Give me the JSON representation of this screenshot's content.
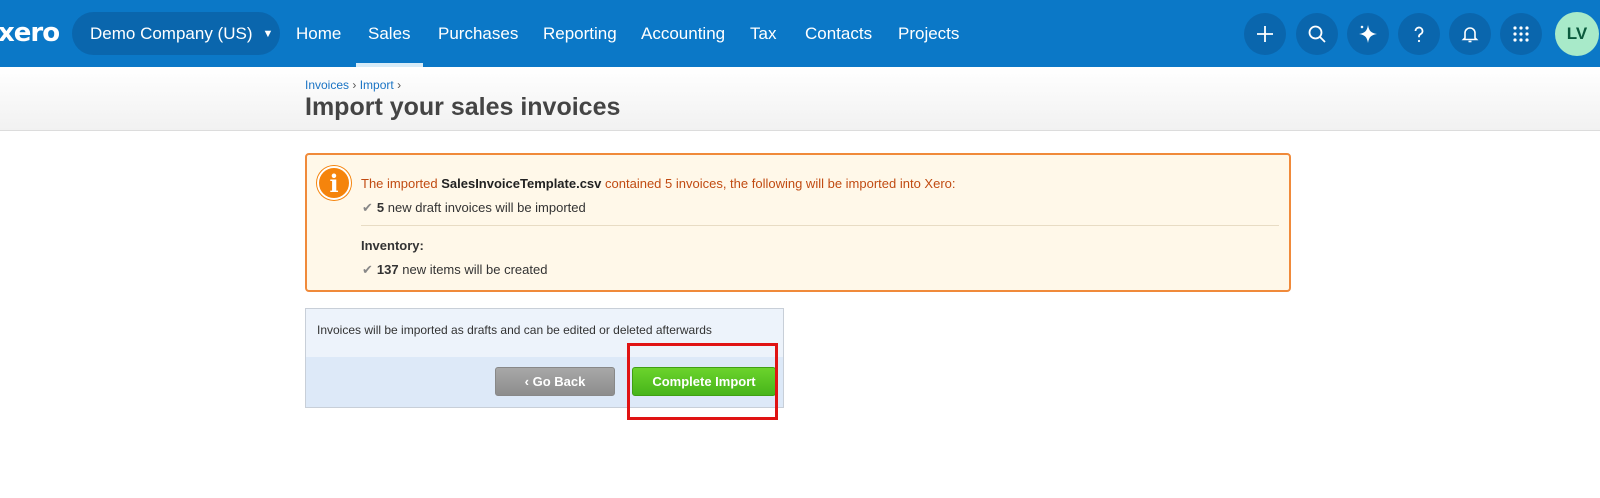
{
  "topbar": {
    "logo": "xero",
    "org_name": "Demo Company (US)",
    "org_caret": "▼",
    "nav": [
      {
        "label": "Home"
      },
      {
        "label": "Sales"
      },
      {
        "label": "Purchases"
      },
      {
        "label": "Reporting"
      },
      {
        "label": "Accounting"
      },
      {
        "label": "Tax"
      },
      {
        "label": "Contacts"
      },
      {
        "label": "Projects"
      }
    ],
    "active_nav": "Sales",
    "icons": [
      "plus-icon",
      "search-icon",
      "sparkle-icon",
      "help-icon",
      "bell-icon",
      "apps-grid-icon"
    ],
    "avatar_initials": "LV",
    "colors": {
      "bar": "#0b78c7",
      "pill": "#0a66ad",
      "avatar": "#a8eac9"
    }
  },
  "header": {
    "breadcrumb": [
      {
        "label": "Invoices"
      },
      {
        "label": "Import"
      }
    ],
    "separator": "›",
    "title": "Import your sales invoices"
  },
  "info": {
    "msg_prefix": "The imported",
    "filename": "SalesInvoiceTemplate.csv",
    "msg_suffix": "contained 5 invoices, the following will be imported into Xero:",
    "invoices_count": "5",
    "invoices_text": "new draft invoices will be imported",
    "inventory_label": "Inventory:",
    "items_count": "137",
    "items_text": "new items will be created",
    "icon_glyph": "i",
    "check_glyph": "✔",
    "colors": {
      "border": "#f08a3a",
      "background": "#fff8e9",
      "icon": "#f5840c"
    }
  },
  "panel": {
    "note": "Invoices will be imported as drafts and can be edited or deleted afterwards",
    "back_label": "‹ Go Back",
    "complete_label": "Complete Import",
    "colors": {
      "complete": "#47b51a",
      "back": "#8d8d8d",
      "highlight": "#e01313"
    }
  }
}
